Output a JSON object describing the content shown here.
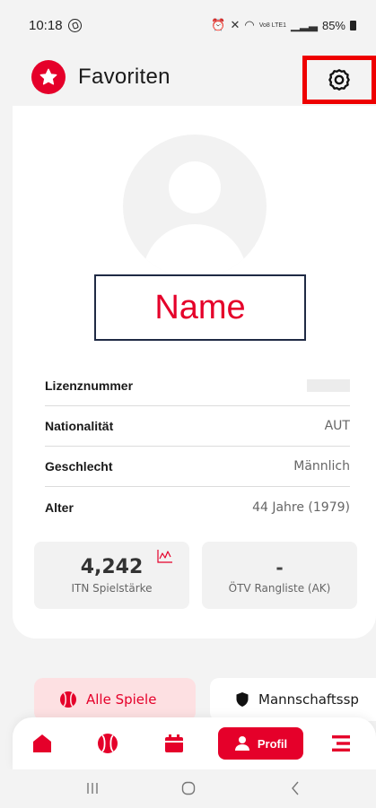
{
  "status_bar": {
    "time": "10:18",
    "network": "Vo8 LTE1",
    "battery": "85%"
  },
  "header": {
    "title": "Favoriten"
  },
  "profile": {
    "name_placeholder": "Name",
    "fields": [
      {
        "label": "Lizenznummer",
        "value": ""
      },
      {
        "label": "Nationalität",
        "value": "AUT"
      },
      {
        "label": "Geschlecht",
        "value": "Männlich"
      },
      {
        "label": "Alter",
        "value": "44 Jahre (1979)"
      }
    ],
    "stats": {
      "itn_value": "4,242",
      "itn_label": "ITN Spielstärke",
      "oetv_value": "-",
      "oetv_label": "ÖTV Rangliste (AK)"
    }
  },
  "filters": {
    "all_games": "Alle Spiele",
    "team_games": "Mannschaftssp"
  },
  "nav": {
    "profile_label": "Profil"
  },
  "colors": {
    "accent": "#e5002a",
    "accent_light": "#fde0e2",
    "highlight_box": "#ee0000"
  }
}
